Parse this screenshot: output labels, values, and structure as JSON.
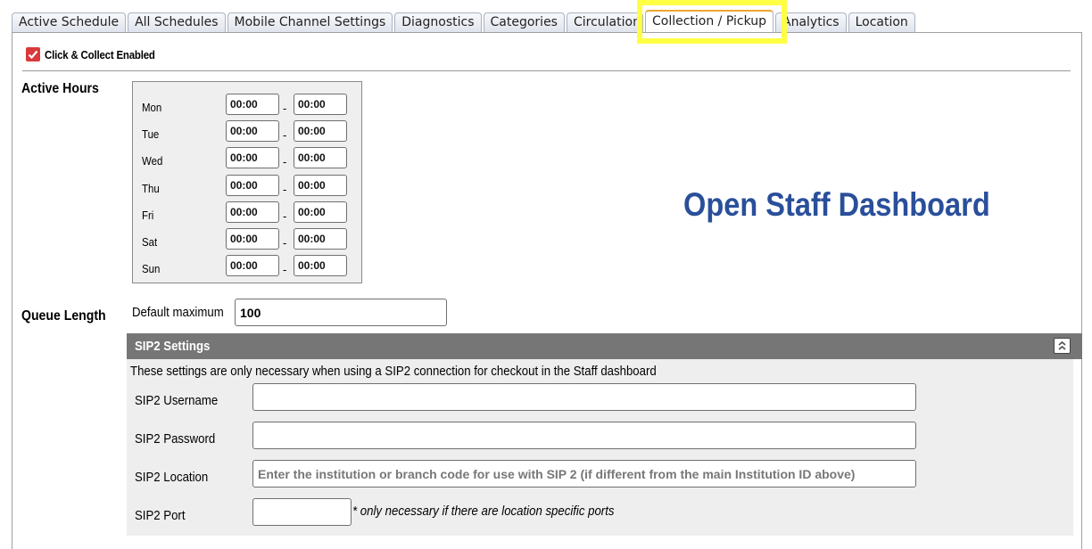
{
  "tabs": [
    {
      "label": "Active Schedule",
      "active": false
    },
    {
      "label": "All Schedules",
      "active": false
    },
    {
      "label": "Mobile Channel Settings",
      "active": false
    },
    {
      "label": "Diagnostics",
      "active": false
    },
    {
      "label": "Categories",
      "active": false
    },
    {
      "label": "Circulation",
      "active": false
    },
    {
      "label": "Collection / Pickup",
      "active": true
    },
    {
      "label": "Analytics",
      "active": false
    },
    {
      "label": "Location",
      "active": false
    }
  ],
  "click_collect": {
    "label": "Click & Collect Enabled",
    "checked": true
  },
  "active_hours": {
    "label": "Active Hours",
    "separator": "-",
    "days": [
      {
        "day": "Mon",
        "start": "00:00",
        "end": "00:00"
      },
      {
        "day": "Tue",
        "start": "00:00",
        "end": "00:00"
      },
      {
        "day": "Wed",
        "start": "00:00",
        "end": "00:00"
      },
      {
        "day": "Thu",
        "start": "00:00",
        "end": "00:00"
      },
      {
        "day": "Fri",
        "start": "00:00",
        "end": "00:00"
      },
      {
        "day": "Sat",
        "start": "00:00",
        "end": "00:00"
      },
      {
        "day": "Sun",
        "start": "00:00",
        "end": "00:00"
      }
    ]
  },
  "open_dashboard": {
    "label": "Open Staff Dashboard",
    "color": "#2a4f9a"
  },
  "queue": {
    "label": "Queue Length",
    "default_label": "Default maximum",
    "default_value": "100"
  },
  "sip2": {
    "title": "SIP2 Settings",
    "note": "These settings are only necessary when using a SIP2 connection for checkout in the Staff dashboard",
    "username": {
      "label": "SIP2 Username",
      "value": "",
      "placeholder": ""
    },
    "password": {
      "label": "SIP2 Password",
      "value": "",
      "placeholder": ""
    },
    "location": {
      "label": "SIP2 Location",
      "value": "",
      "placeholder": "Enter the institution or branch code for use with SIP 2 (if different from the main Institution ID above)"
    },
    "port": {
      "label": "SIP2 Port",
      "value": "",
      "note": "* only necessary if there are location specific ports"
    }
  },
  "colors": {
    "highlight": "#ffff44",
    "active_tab_accent": "#f0a530",
    "checkbox": "#d9393c",
    "section_header": "#767676"
  }
}
